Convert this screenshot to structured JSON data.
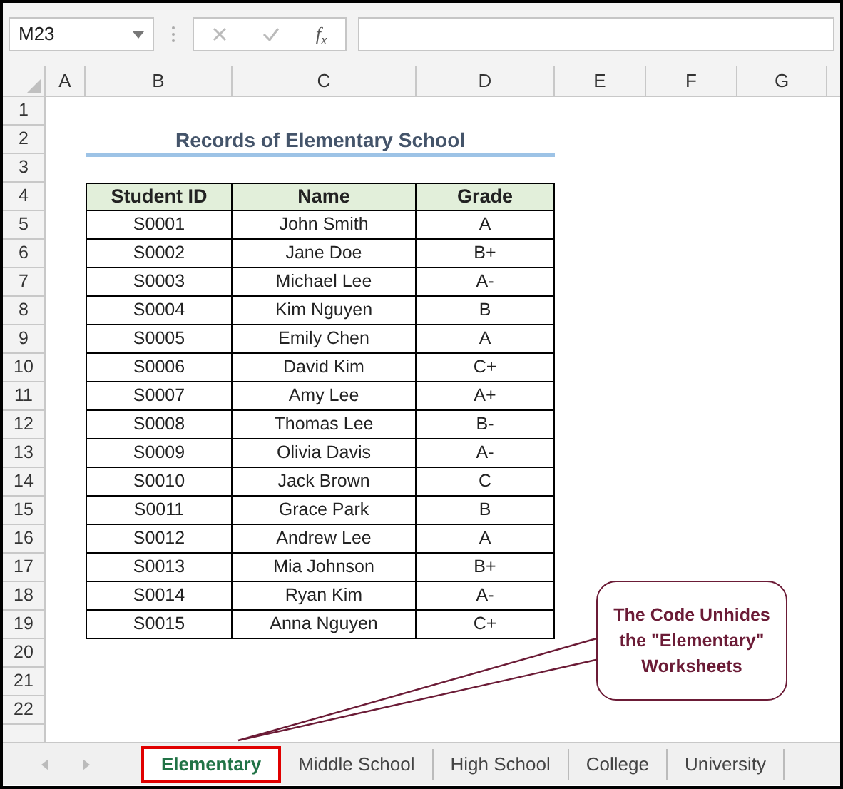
{
  "name_box": {
    "value": "M23"
  },
  "formula_bar": {
    "function_label": "f$_{x}$"
  },
  "column_headers": [
    "A",
    "B",
    "C",
    "D",
    "E",
    "F",
    "G"
  ],
  "row_headers": [
    "1",
    "2",
    "3",
    "4",
    "5",
    "6",
    "7",
    "8",
    "9",
    "10",
    "11",
    "12",
    "13",
    "14",
    "15",
    "16",
    "17",
    "18",
    "19",
    "20",
    "21",
    "22"
  ],
  "title": "Records of Elementary School",
  "table": {
    "columns": [
      "Student ID",
      "Name",
      "Grade"
    ],
    "rows": [
      [
        "S0001",
        "John Smith",
        "A"
      ],
      [
        "S0002",
        "Jane Doe",
        "B+"
      ],
      [
        "S0003",
        "Michael Lee",
        "A-"
      ],
      [
        "S0004",
        "Kim Nguyen",
        "B"
      ],
      [
        "S0005",
        "Emily Chen",
        "A"
      ],
      [
        "S0006",
        "David Kim",
        "C+"
      ],
      [
        "S0007",
        "Amy Lee",
        "A+"
      ],
      [
        "S0008",
        "Thomas Lee",
        "B-"
      ],
      [
        "S0009",
        "Olivia Davis",
        "A-"
      ],
      [
        "S0010",
        "Jack Brown",
        "C"
      ],
      [
        "S0011",
        "Grace Park",
        "B"
      ],
      [
        "S0012",
        "Andrew Lee",
        "A"
      ],
      [
        "S0013",
        "Mia Johnson",
        "B+"
      ],
      [
        "S0014",
        "Ryan Kim",
        "A-"
      ],
      [
        "S0015",
        "Anna Nguyen",
        "C+"
      ]
    ]
  },
  "callout": "The Code Unhides the \"Elementary\" Worksheets",
  "sheet_tabs": [
    {
      "label": "Elementary",
      "selected": true
    },
    {
      "label": "Middle School",
      "selected": false
    },
    {
      "label": "High School",
      "selected": false
    },
    {
      "label": "College",
      "selected": false
    },
    {
      "label": "University",
      "selected": false
    }
  ]
}
